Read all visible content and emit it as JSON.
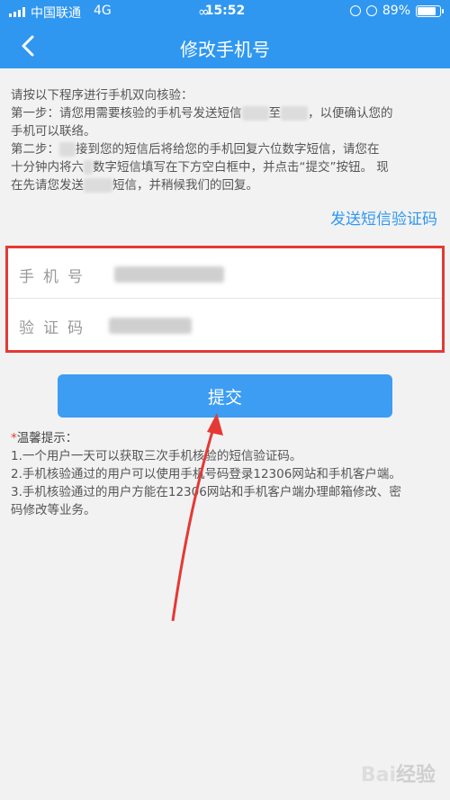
{
  "status_bar": {
    "carrier": "中国联通",
    "network": "4G",
    "link_icon": "link-icon",
    "time": "15:52",
    "battery": "89%",
    "battery_level": 0.89
  },
  "nav": {
    "title": "修改手机号",
    "back_icon": "back-arrow-icon"
  },
  "intro": {
    "line1": "请按以下程序进行手机双向核验：",
    "line2a": "第一步：请您用需要核验的手机号发送短信",
    "line2b": "至",
    "line2c": "，以便确认您的",
    "line3": "手机可以联络。",
    "line4a": "第二步：",
    "line4b": "接到您的短信后将给您的手机回复六位数字短信，请您在",
    "line5a": "十分钟内将六",
    "line5b": "数字短信填写在下方空白框中，并点击“提交”按钮。 现",
    "line6a": "在先请您发送",
    "line6b": "短信，并稍候我们的回复。"
  },
  "send_code_label": "发送短信验证码",
  "form": {
    "phone_label": "手机号",
    "code_label": "验证码"
  },
  "submit_label": "提交",
  "tips": {
    "title_star": "*",
    "title": "温馨提示：",
    "items": [
      "1.一个用户一天可以获取三次手机核验的短信验证码。",
      "2.手机核验通过的用户可以使用手机号码登录12306网站和手机客户端。",
      "3.手机核验通过的用户方能在12306网站和手机客户端办理邮箱修改、密",
      "码修改等业务。"
    ]
  },
  "watermark": "Bai经验",
  "colors": {
    "primary": "#2f97f0",
    "highlight_border": "#e53935",
    "annotation_arrow": "#e53935"
  }
}
